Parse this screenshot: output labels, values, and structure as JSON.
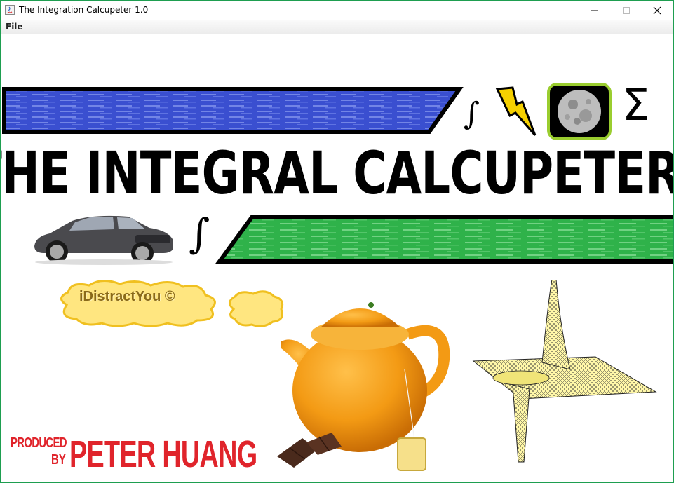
{
  "window": {
    "title": "The Integration Calcupeter 1.0",
    "controls": {
      "minimize": "—",
      "maximize": "☐",
      "close": "✕"
    }
  },
  "menubar": {
    "items": [
      {
        "label": "File"
      }
    ]
  },
  "banner": {
    "title": "THE INTEGRAL CALCUPETER",
    "integral_symbol": "∫",
    "sigma_symbol": "Σ"
  },
  "cloud": {
    "label": "iDistractYou ©"
  },
  "credits": {
    "produced": "PRODUCED",
    "by": "BY",
    "name": "PETER HUANG"
  },
  "colors": {
    "blue_bar": "#3a4fd0",
    "green_bar": "#2fb24a",
    "moon_frame": "#9acd2f",
    "lightning": "#f5d000",
    "cloud": "#ffe680",
    "credit_red": "#e0242b",
    "window_border": "#1e9e50"
  },
  "icons": [
    "java-app-icon",
    "lightning-bolt-icon",
    "moon-icon",
    "car-image",
    "orange-teapot-image",
    "tea-bag-image",
    "chocolate-image",
    "wireframe-surface-plot-image",
    "thought-cloud-icon"
  ]
}
